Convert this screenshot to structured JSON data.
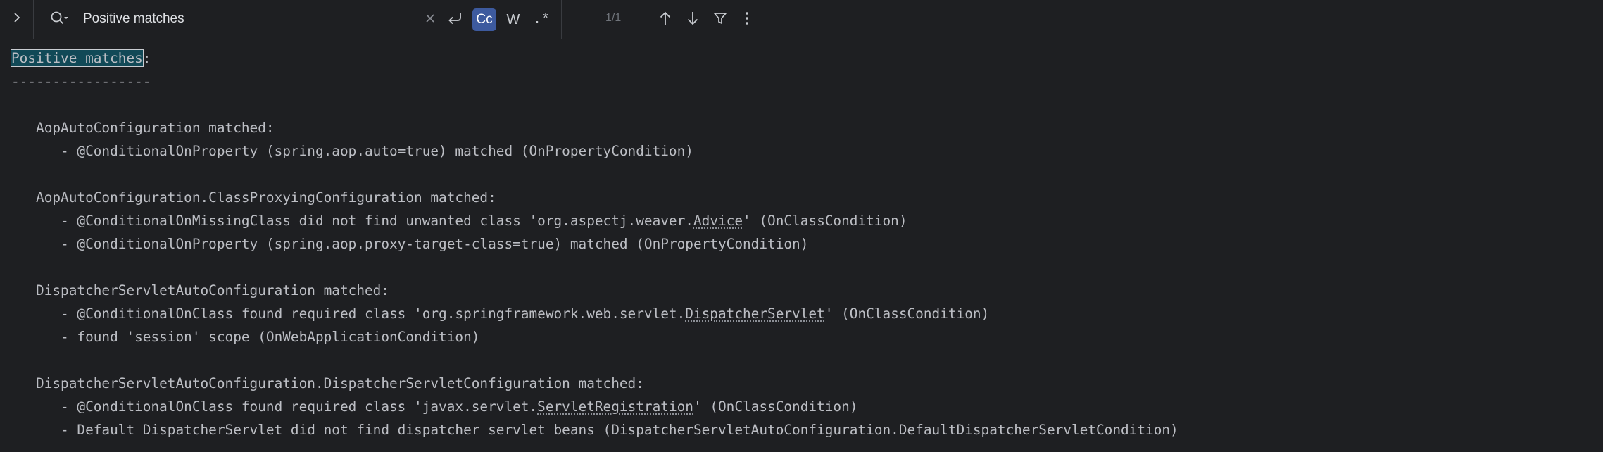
{
  "find_bar": {
    "query": "Positive matches",
    "match_count": "1/1",
    "case_sensitive_label": "Cc",
    "whole_word_label": "W",
    "regex_label": ".*",
    "case_sensitive_active": true
  },
  "editor": {
    "lines": [
      {
        "pre": "",
        "highlight": "Positive matches",
        "post": ":"
      },
      {
        "text": "-----------------"
      },
      {
        "text": ""
      },
      {
        "text": "   AopAutoConfiguration matched:"
      },
      {
        "text": "      - @ConditionalOnProperty (spring.aop.auto=true) matched (OnPropertyCondition)"
      },
      {
        "text": ""
      },
      {
        "text": "   AopAutoConfiguration.ClassProxyingConfiguration matched:"
      },
      {
        "pre": "      - @ConditionalOnMissingClass did not find unwanted class 'org.aspectj.weaver.",
        "underlined": "Advice",
        "post": "' (OnClassCondition)"
      },
      {
        "text": "      - @ConditionalOnProperty (spring.aop.proxy-target-class=true) matched (OnPropertyCondition)"
      },
      {
        "text": ""
      },
      {
        "text": "   DispatcherServletAutoConfiguration matched:"
      },
      {
        "pre": "      - @ConditionalOnClass found required class 'org.springframework.web.servlet.",
        "underlined": "DispatcherServlet",
        "post": "' (OnClassCondition)"
      },
      {
        "text": "      - found 'session' scope (OnWebApplicationCondition)"
      },
      {
        "text": ""
      },
      {
        "text": "   DispatcherServletAutoConfiguration.DispatcherServletConfiguration matched:"
      },
      {
        "pre": "      - @ConditionalOnClass found required class 'javax.servlet.",
        "underlined": "ServletRegistration",
        "post": "' (OnClassCondition)"
      },
      {
        "text": "      - Default DispatcherServlet did not find dispatcher servlet beans (DispatcherServletAutoConfiguration.DefaultDispatcherServletCondition)"
      }
    ]
  },
  "icons": {
    "expand": "chevron-right-icon",
    "search": "search-history-icon",
    "clear": "close-icon",
    "newline": "new-line-icon",
    "prev": "arrow-up-icon",
    "next": "arrow-down-icon",
    "filter": "filter-icon",
    "more": "more-vertical-icon"
  },
  "colors": {
    "background": "#1e1f22",
    "text": "#bcbec4",
    "match_highlight": "#114957",
    "active_toggle": "#3d5a9e"
  }
}
